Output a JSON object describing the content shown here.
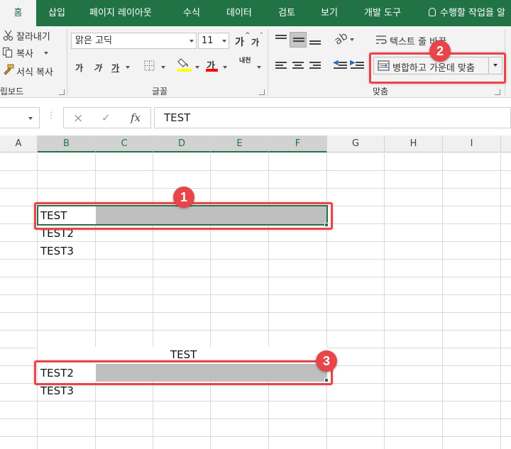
{
  "menu": {
    "tabs": [
      "홈",
      "삽입",
      "페이지 레이아웃",
      "수식",
      "데이터",
      "검토",
      "보기",
      "개발 도구"
    ],
    "tell_me": "수행할 작업을 알"
  },
  "ribbon": {
    "clipboard": {
      "cut": "잘라내기",
      "copy": "복사",
      "format_painter": "서식 복사",
      "group_label": "립보드"
    },
    "font": {
      "font_name": "맑은 고딕",
      "font_size": "11",
      "grow_label": "가",
      "shrink_label": "가",
      "bold": "가",
      "italic": "가",
      "underline": "가",
      "font_color_label": "가",
      "phonetic_label": "내천",
      "group_label": "글꼴",
      "highlight_color": "#ffff00",
      "font_color": "#ff0000"
    },
    "alignment": {
      "wrap_text": "텍스트 줄 바꿈",
      "merge_center": "병합하고 가운데 맞춤",
      "group_label": "맞춤"
    }
  },
  "formula_bar": {
    "cancel_icon": "×",
    "enter_icon": "✓",
    "fx_label": "fx",
    "content": "TEST"
  },
  "grid": {
    "columns": [
      "A",
      "B",
      "C",
      "D",
      "E",
      "F",
      "G",
      "H",
      "I"
    ],
    "selected_columns": [
      "B",
      "C",
      "D",
      "E",
      "F"
    ],
    "cells": {
      "top_b1": "TEST",
      "top_b2": "TEST2",
      "top_b3": "TEST3",
      "merged_title": "TEST",
      "bottom_b2": "TEST2",
      "bottom_b3": "TEST3"
    }
  },
  "annotations": {
    "badge1": "1",
    "badge2": "2",
    "badge3": "3",
    "color": "#e8454b"
  }
}
